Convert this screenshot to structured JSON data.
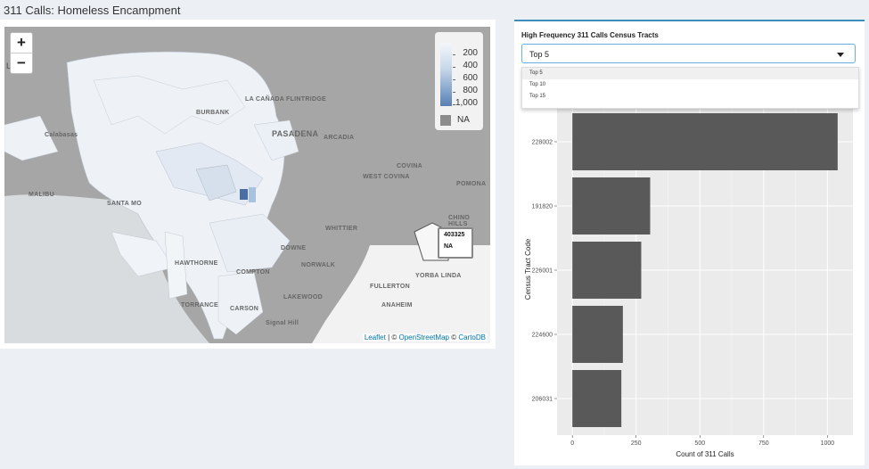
{
  "page_title": "311 Calls: Homeless Encampment",
  "map": {
    "zoom_in": "+",
    "zoom_out": "−",
    "legend": {
      "labels": [
        "200",
        "400",
        "600",
        "800",
        "1,000"
      ],
      "na_label": "NA"
    },
    "attribution": {
      "leaflet": "Leaflet",
      "sep1": " | © ",
      "osm": "OpenStreetMap",
      "sep2": " © ",
      "carto": "CartoDB"
    },
    "tooltip": {
      "tract": "403325",
      "value": "NA"
    },
    "places": [
      "LA CAÑADA FLINTRIDGE",
      "BURBANK",
      "PASADENA",
      "ARCADIA",
      "Calabasas",
      "COVINA",
      "WEST COVINA",
      "POMONA",
      "MALIBU",
      "SANTA MO",
      "WHITTIER",
      "CHINO HILLS",
      "DOWNE",
      "NORWALK",
      "HAWTHORNE",
      "COMPTON",
      "FULLERTON",
      "YORBA LINDA",
      "LAKEWOOD",
      "ANAHEIM",
      "TORRANCE",
      "CARSON",
      "Signal Hill",
      "L"
    ]
  },
  "selector": {
    "label": "High Frequency 311 Calls Census Tracts",
    "value": "Top 5",
    "options": [
      "Top 5",
      "Top 10",
      "Top 15"
    ]
  },
  "chart_data": {
    "type": "bar",
    "orientation": "horizontal",
    "categories": [
      "228002",
      "191820",
      "226001",
      "224600",
      "206031"
    ],
    "values": [
      1040,
      305,
      270,
      198,
      192
    ],
    "xlabel": "Count of 311 Calls",
    "ylabel": "Census Tract Code",
    "xticks": [
      "0",
      "250",
      "500",
      "750",
      "1000"
    ],
    "xlim": [
      -60,
      1100
    ],
    "grid": true,
    "bar_color": "#595959",
    "panel_color": "#ebebeb"
  }
}
